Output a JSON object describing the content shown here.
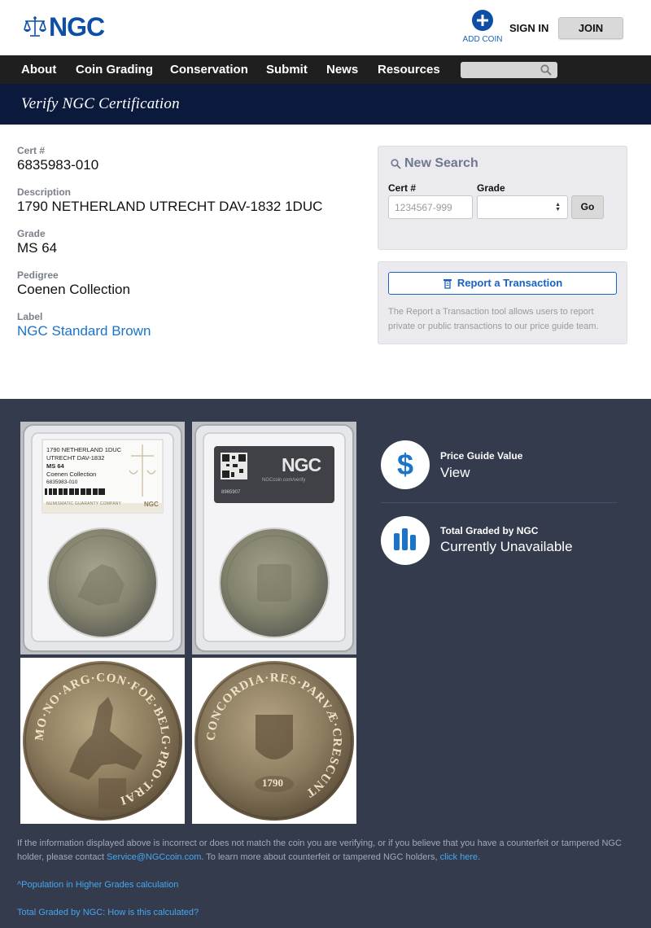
{
  "header": {
    "logo_text": "NGC",
    "add_coin_label": "ADD COIN",
    "sign_in_label": "SIGN IN",
    "join_label": "JOIN"
  },
  "nav": {
    "items": [
      "About",
      "Coin Grading",
      "Conservation",
      "Submit",
      "News",
      "Resources"
    ],
    "search_placeholder": ""
  },
  "page": {
    "title": "Verify NGC Certification"
  },
  "details": {
    "cert_label": "Cert #",
    "cert_value": "6835983-010",
    "description_label": "Description",
    "description_value": "1790 NETHERLAND UTRECHT DAV-1832 1DUC",
    "grade_label": "Grade",
    "grade_value": "MS 64",
    "pedigree_label": "Pedigree",
    "pedigree_value": "Coenen Collection",
    "label_label": "Label",
    "label_value": "NGC Standard Brown"
  },
  "new_search": {
    "title": "New Search",
    "cert_label": "Cert #",
    "cert_placeholder": "1234567-999",
    "grade_label": "Grade",
    "grade_value": "",
    "go_label": "Go"
  },
  "report": {
    "button_label": "Report a Transaction",
    "description": "The Report a Transaction tool allows users to report private or public transactions to our price guide team."
  },
  "slab_label": {
    "line1": "1790 NETHERLAND 1DUC",
    "line2": "UTRECHT DAV-1832",
    "grade": "MS 64",
    "pedigree": "Coenen Collection",
    "cert": "6835983-010",
    "footer": "NUMISMATIC GUARANTY COMPANY",
    "back_url": "NGCcoin.com/verify",
    "back_number": "8965907"
  },
  "coin_legend": {
    "obverse_text": "MO·NO·ARG·CON·FOE·BELG·PRO·TRAI",
    "reverse_text": "CONCORDIA·RES·PARVÆ·CRESCUNT",
    "reverse_date": "1790"
  },
  "stats": {
    "price_label": "Price Guide Value",
    "price_value": "View",
    "graded_label": "Total Graded by NGC",
    "graded_value": "Currently Unavailable"
  },
  "footer": {
    "text_part1": "If the information displayed above is incorrect or does not match the coin you are verifying, or if you believe that you have a counterfeit or tampered NGC holder, please contact ",
    "email": "Service@NGCcoin.com",
    "text_part2": ". To learn more about counterfeit or tampered NGC holders, ",
    "click_here": "click here",
    "text_part3": ".",
    "population_link": "^Population in Higher Grades calculation",
    "total_graded_link": "Total Graded by NGC: How is this calculated?"
  },
  "colors": {
    "brand_blue": "#0d4ea6",
    "nav_bg": "#1f1f1f",
    "title_band_bg": "#0b1a3c",
    "dark_section_bg": "#333b4d",
    "link_blue": "#1a74c9",
    "stat_icon_blue": "#1a74c9"
  }
}
